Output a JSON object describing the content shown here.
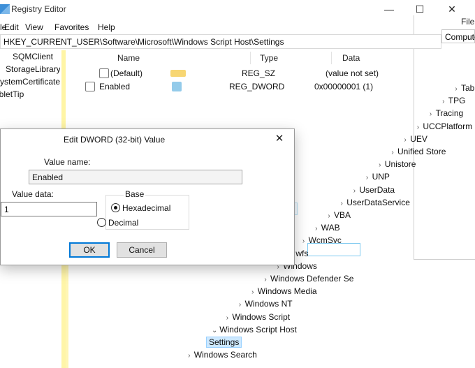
{
  "window": {
    "title": "Registry Editor",
    "min_glyph": "—",
    "max_glyph": "☐",
    "close_glyph": "✕"
  },
  "menu": [
    "File",
    "Edit",
    "View",
    "Favorites",
    "Help"
  ],
  "address": "HKEY_CURRENT_USER\\Software\\Microsoft\\Windows Script Host\\Settings",
  "tree": [
    "SQMClient",
    "StorageLibrary",
    "SystemCertificates",
    "TabletTip"
  ],
  "list": {
    "headers": [
      "Name",
      "Type",
      "Data"
    ],
    "rows": [
      {
        "name": "(Default)",
        "type": "REG_SZ",
        "data": "(value not set)",
        "icon_color": "#f0b400"
      },
      {
        "name": "Enabled",
        "type": "REG_DWORD",
        "data": "0x00000001 (1)",
        "icon_color": "#3aa0d8"
      }
    ]
  },
  "explorer": {
    "menu_label": "File",
    "address": "Computer"
  },
  "cascade": [
    {
      "label": "TabletTip",
      "chev": "›"
    },
    {
      "label": "TPG",
      "chev": "›"
    },
    {
      "label": "Tracing",
      "chev": "›"
    },
    {
      "label": "UCCPlatform",
      "chev": "›"
    },
    {
      "label": "UEV",
      "chev": "›"
    },
    {
      "label": "Unified Store",
      "chev": "›"
    },
    {
      "label": "Unistore",
      "chev": "›"
    },
    {
      "label": "UNP",
      "chev": "›"
    },
    {
      "label": "UserData",
      "chev": "›"
    },
    {
      "label": "UserDataService",
      "chev": "›"
    },
    {
      "label": "VBA",
      "chev": "›"
    },
    {
      "label": "WAB",
      "chev": "›"
    },
    {
      "label": "WcmSvc",
      "chev": "›"
    },
    {
      "label": "wfs",
      "chev": "›"
    },
    {
      "label": "Windows",
      "chev": "›"
    },
    {
      "label": "Windows Defender Se",
      "chev": "›"
    },
    {
      "label": "Windows Media",
      "chev": "›"
    },
    {
      "label": "Windows NT",
      "chev": "›"
    },
    {
      "label": "Windows Script",
      "chev": "›"
    },
    {
      "label": "Windows Script Host",
      "chev": "⌄"
    },
    {
      "label": "Settings",
      "chev": ""
    },
    {
      "label": "Windows Search",
      "chev": "›"
    }
  ],
  "dialog": {
    "title": "Edit DWORD (32-bit) Value",
    "close_glyph": "✕",
    "value_name_label": "Value name:",
    "value_name": "Enabled",
    "value_data_label": "Value data:",
    "value_data": "1",
    "base_label": "Base",
    "radios": [
      {
        "label": "Hexadecimal",
        "checked": true
      },
      {
        "label": "Decimal",
        "checked": false
      }
    ],
    "ok_label": "OK",
    "cancel_label": "Cancel"
  }
}
